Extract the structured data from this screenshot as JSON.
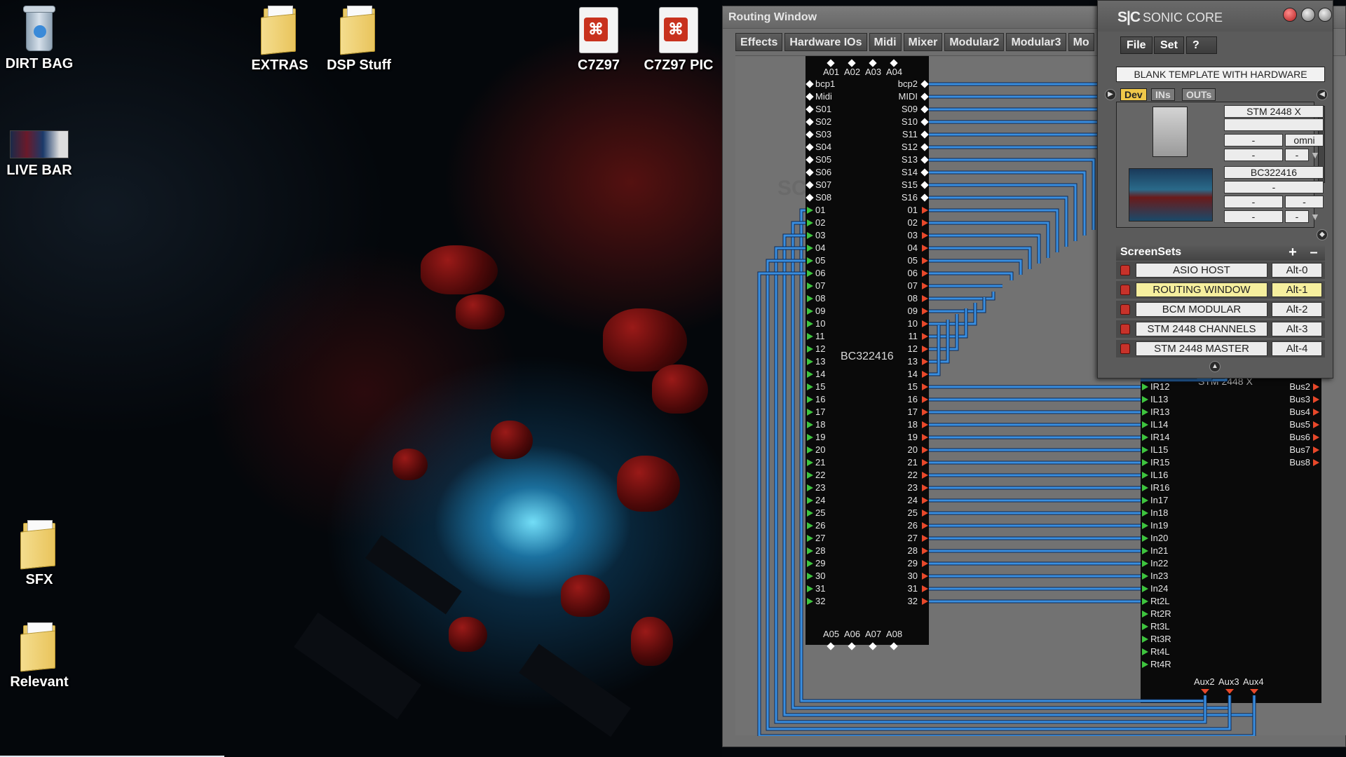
{
  "desktop": {
    "icons": [
      {
        "label": "DIRT BAG",
        "kind": "recycle-bin"
      },
      {
        "label": "LIVE BAR",
        "kind": "image"
      },
      {
        "label": "SFX",
        "kind": "folder"
      },
      {
        "label": "Relevant",
        "kind": "folder"
      },
      {
        "label": "EXTRAS",
        "kind": "folder"
      },
      {
        "label": "DSP Stuff",
        "kind": "folder"
      },
      {
        "label": "C7Z97",
        "kind": "pdf"
      },
      {
        "label": "C7Z97 PIC",
        "kind": "pdf"
      }
    ],
    "folder_mark": "s|c",
    "pdf_mark": "⌘"
  },
  "routing_window": {
    "title": "Routing Window",
    "tabs": [
      "Effects",
      "Hardware IOs",
      "Midi",
      "Mixer",
      "Modular2",
      "Modular3",
      "Mo"
    ],
    "watermark": "SC",
    "bc_module": {
      "name": "BC322416",
      "top_ports": [
        "A01",
        "A02",
        "A03",
        "A04"
      ],
      "bottom_ports": [
        "A05",
        "A06",
        "A07",
        "A08"
      ],
      "left_ports": [
        "bcp1",
        "Midi",
        "S01",
        "S02",
        "S03",
        "S04",
        "S05",
        "S06",
        "S07",
        "S08",
        "01",
        "02",
        "03",
        "04",
        "05",
        "06",
        "07",
        "08",
        "09",
        "10",
        "11",
        "12",
        "13",
        "14",
        "15",
        "16",
        "17",
        "18",
        "19",
        "20",
        "21",
        "22",
        "23",
        "24",
        "25",
        "26",
        "27",
        "28",
        "29",
        "30",
        "31",
        "32"
      ],
      "right_ports": [
        "bcp2",
        "MIDI",
        "S09",
        "S10",
        "S11",
        "S12",
        "S13",
        "S14",
        "S15",
        "S16",
        "01",
        "02",
        "03",
        "04",
        "05",
        "06",
        "07",
        "08",
        "09",
        "10",
        "11",
        "12",
        "13",
        "14",
        "15",
        "16",
        "17",
        "18",
        "19",
        "20",
        "21",
        "22",
        "23",
        "24",
        "25",
        "26",
        "27",
        "28",
        "29",
        "30",
        "31",
        "32"
      ]
    },
    "stm_module": {
      "name": "STM 2448 X",
      "left_ports": [
        "IR12",
        "IL13",
        "IR13",
        "IL14",
        "IR14",
        "IL15",
        "IR15",
        "IL16",
        "IR16",
        "In17",
        "In18",
        "In19",
        "In20",
        "In21",
        "In22",
        "In23",
        "In24",
        "Rt2L",
        "Rt2R",
        "Rt3L",
        "Rt3R",
        "Rt4L",
        "Rt4R"
      ],
      "right_ports": [
        "Bus2",
        "Bus3",
        "Bus4",
        "Bus5",
        "Bus6",
        "Bus7",
        "Bus8"
      ],
      "bottom_ports": [
        "Aux2",
        "Aux3",
        "Aux4"
      ]
    },
    "colors": {
      "wire": "#3a8fe0",
      "wire_edge": "#0d2a55",
      "port_in": "#3ec43e",
      "port_out": "#e8482a"
    }
  },
  "sonic_core": {
    "logo": "S|C",
    "title": "SONIC CORE",
    "menu": [
      "File",
      "Set",
      "?"
    ],
    "project": "BLANK TEMPLATE WITH HARDWARE",
    "tabs": [
      "Dev",
      "INs",
      "OUTs"
    ],
    "devices": [
      {
        "name": "STM 2448 X",
        "field2": "",
        "field3": "-",
        "field4": "omni",
        "field5": "-",
        "field6": "-"
      },
      {
        "name": "BC322416",
        "field2": "-",
        "field3": "-",
        "field4": "-",
        "field5": "-",
        "field6": "-"
      }
    ],
    "screensets_label": "ScreenSets",
    "screensets_add": "+",
    "screensets_remove": "–",
    "screensets": [
      {
        "name": "ASIO HOST",
        "key": "Alt-0",
        "active": false
      },
      {
        "name": "ROUTING WINDOW",
        "key": "Alt-1",
        "active": true
      },
      {
        "name": "BCM MODULAR",
        "key": "Alt-2",
        "active": false
      },
      {
        "name": "STM 2448 CHANNELS",
        "key": "Alt-3",
        "active": false
      },
      {
        "name": "STM 2448 MASTER",
        "key": "Alt-4",
        "active": false
      }
    ],
    "colors": {
      "active_tab": "#f0c84a",
      "active_row": "#f6ef9e",
      "lock": "#c8322a"
    }
  }
}
